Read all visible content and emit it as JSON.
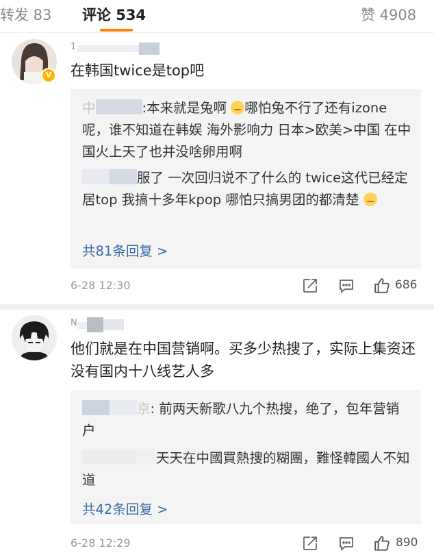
{
  "tabs": {
    "repost": "转发 83",
    "comments": "评论 534",
    "likes": "赞 4908"
  },
  "comments": [
    {
      "username_fragment": "1",
      "text": "在韩国twice是top吧",
      "replies": [
        {
          "author_fragment": "中",
          "text": ":本来就是兔啊",
          "text_after_emoji": "哪怕兔不行了还有izone呢，谁不知道在韩娱 海外影响力 日本>欧美>中国 在中国火上天了也并没啥卵用啊"
        },
        {
          "author_fragment": "",
          "text": "服了 一次回归说不了什么的 twice这代已经定居top 我搞十多年kpop 哪怕只搞男团的都清楚"
        }
      ],
      "more_replies": "共81条回复 >",
      "time": "6-28 12:30",
      "like_count": "686"
    },
    {
      "username_fragment": "N",
      "text": "他们就是在中国营销啊。买多少热搜了，实际上集资还没有国内十八线艺人多",
      "replies": [
        {
          "author_fragment": "京",
          "text": ": 前两天新歌八九个热搜，绝了，包年营销户"
        },
        {
          "author_fragment": "",
          "text": "天天在中國買熱搜的糊團，難怪韓國人不知道"
        }
      ],
      "more_replies": "共42条回复 >",
      "time": "6-28 12:29",
      "like_count": "890"
    }
  ]
}
